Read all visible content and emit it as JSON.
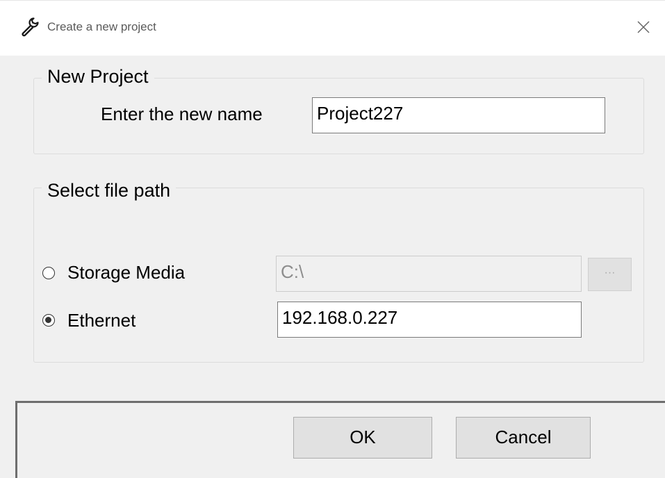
{
  "window": {
    "title": "Create a new project",
    "icon": "wrench-icon",
    "close_icon": "close-icon"
  },
  "new_project": {
    "legend": "New Project",
    "name_label": "Enter the new name",
    "name_value": "Project227"
  },
  "file_path": {
    "legend": "Select file path",
    "storage_media": {
      "label": "Storage Media",
      "selected": false,
      "path_value": "C:\\",
      "enabled": false,
      "browse_label": "···"
    },
    "ethernet": {
      "label": "Ethernet",
      "selected": true,
      "address_value": "192.168.0.227"
    }
  },
  "buttons": {
    "ok": "OK",
    "cancel": "Cancel"
  }
}
